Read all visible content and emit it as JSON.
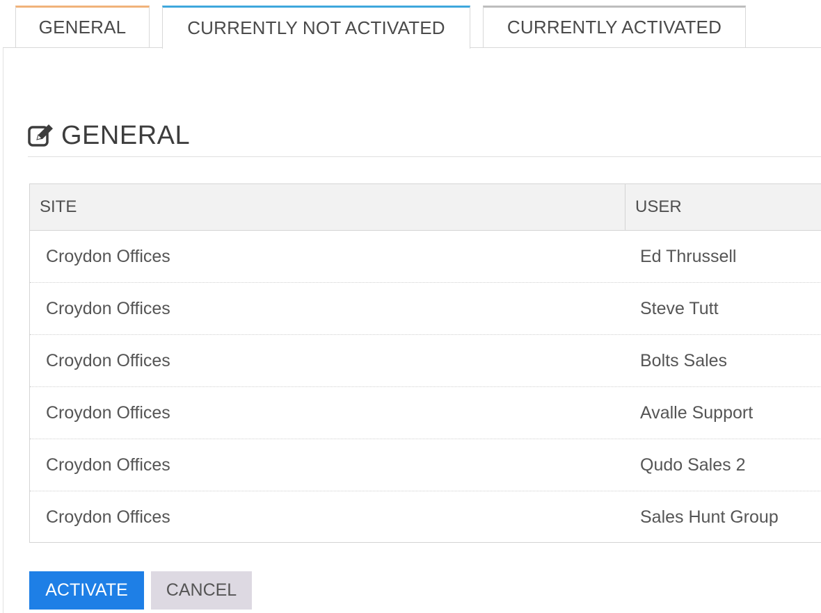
{
  "tabs": [
    {
      "label": "GENERAL",
      "accent": "#f0b27a"
    },
    {
      "label": "CURRENTLY NOT ACTIVATED",
      "accent": "#3ea7dc"
    },
    {
      "label": "CURRENTLY ACTIVATED",
      "accent": "#bdbdbd"
    }
  ],
  "section": {
    "title": "GENERAL",
    "icon": "edit-icon"
  },
  "table": {
    "columns": [
      "SITE",
      "USER"
    ],
    "rows": [
      {
        "site": "Croydon Offices",
        "user": "Ed Thrussell"
      },
      {
        "site": "Croydon Offices",
        "user": "Steve Tutt"
      },
      {
        "site": "Croydon Offices",
        "user": "Bolts Sales"
      },
      {
        "site": "Croydon Offices",
        "user": "Avalle Support"
      },
      {
        "site": "Croydon Offices",
        "user": "Qudo Sales 2"
      },
      {
        "site": "Croydon Offices",
        "user": "Sales Hunt Group"
      }
    ]
  },
  "buttons": {
    "activate": "ACTIVATE",
    "cancel": "CANCEL"
  },
  "colors": {
    "primary": "#1e7fe6",
    "secondary": "#ddd9e2",
    "header_bg": "#f2f2f2"
  }
}
